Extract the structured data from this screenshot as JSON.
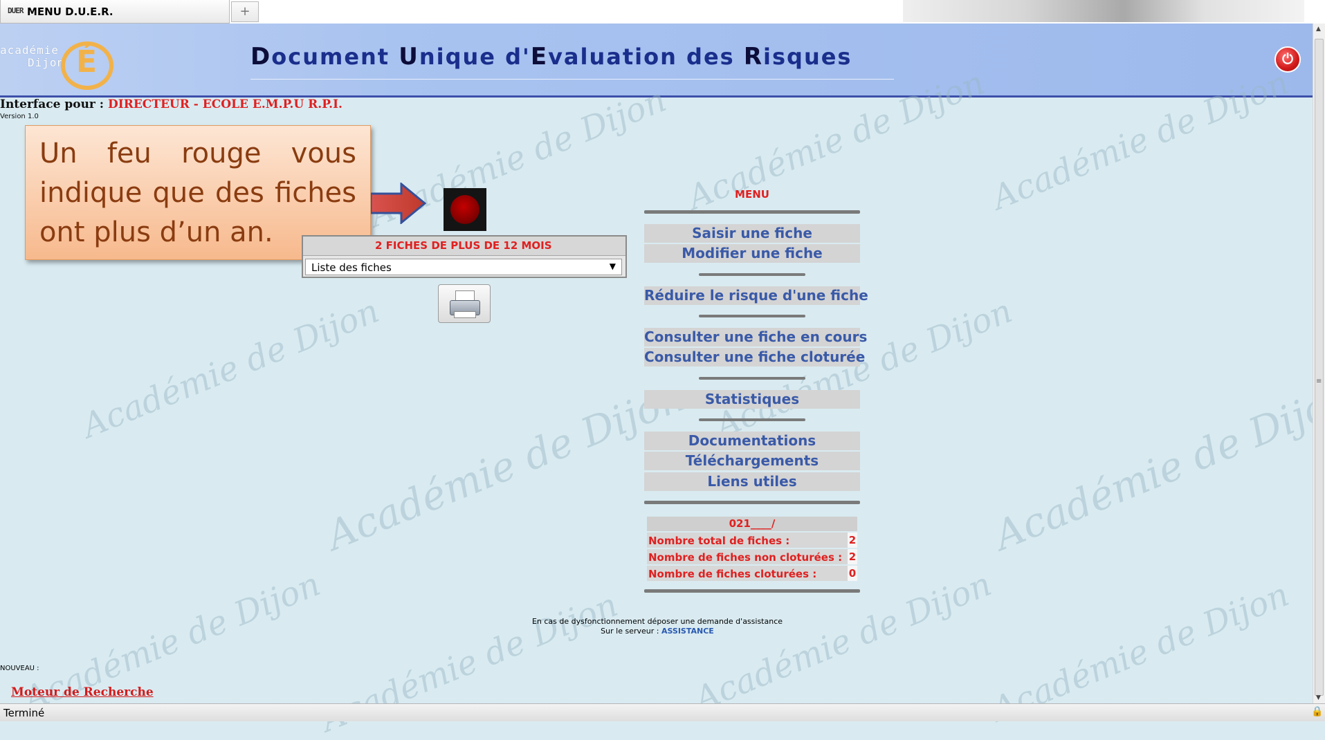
{
  "browser": {
    "tab_favicon": "DUER",
    "tab_title": "MENU D.U.E.R.",
    "new_tab": "+"
  },
  "header": {
    "logo_text_1": "académie",
    "logo_text_2": "Dijon",
    "logo_letter": "É",
    "title_parts": [
      {
        "cap": "D",
        "rest": "ocument "
      },
      {
        "cap": "U",
        "rest": "nique d'"
      },
      {
        "cap": "E",
        "rest": "valuation des "
      },
      {
        "cap": "R",
        "rest": "isques"
      }
    ],
    "power_icon": "⏻"
  },
  "interface": {
    "label": "Interface pour :",
    "value": "DIRECTEUR - ECOLE E.M.P.U R.P.I.",
    "version": "Version 1.0"
  },
  "watermark": "Académie de Dijon",
  "callout": {
    "text": "Un feu rouge vous indique que des fiches ont plus d’un an."
  },
  "fiches": {
    "alert": "2 FICHES DE PLUS DE 12 MOIS",
    "select_value": "Liste des fiches"
  },
  "menu": {
    "title": "MENU",
    "items": [
      "Saisir une fiche",
      "Modifier une fiche",
      "Réduire le risque d'une fiche",
      "Consulter une fiche en cours",
      "Consulter une fiche cloturée",
      "Statistiques",
      "Documentations",
      "Téléchargements",
      "Liens utiles"
    ]
  },
  "stats": {
    "code": "021____/",
    "rows": [
      {
        "label": "Nombre total de fiches :",
        "value": "2"
      },
      {
        "label": "Nombre de fiches non cloturées :",
        "value": "2"
      },
      {
        "label": "Nombre de fiches cloturées :",
        "value": "0"
      }
    ]
  },
  "footer": {
    "line1": "En cas de dysfonctionnement déposer une demande d'assistance",
    "line2_prefix": "Sur le serveur :",
    "line2_link": "ASSISTANCE"
  },
  "nouveau": "NOUVEAU :",
  "moteur": "Moteur de Recherche",
  "status": "Terminé",
  "colors": {
    "header_bg": "#a9c3f0",
    "page_bg": "#d9ebf1",
    "alert_red": "#e02020",
    "menu_blue": "#3a5aa8"
  }
}
